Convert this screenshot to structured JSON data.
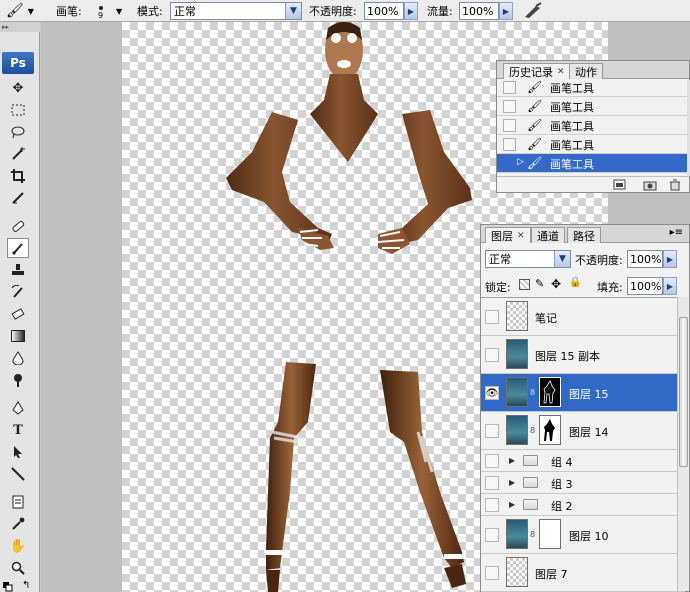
{
  "options_bar": {
    "brush_label": "画笔:",
    "brush_size": "9",
    "mode_label": "模式:",
    "mode_value": "正常",
    "opacity_label": "不透明度:",
    "opacity_value": "100%",
    "flow_label": "流量:",
    "flow_value": "100%"
  },
  "toolbox": {
    "logo": "Ps",
    "tools": [
      "move-icon",
      "marquee-icon",
      "lasso-icon",
      "magic-wand-icon",
      "crop-icon",
      "slice-icon",
      "healing-brush-icon",
      "brush-icon",
      "clone-stamp-icon",
      "history-brush-icon",
      "eraser-icon",
      "gradient-icon",
      "blur-icon",
      "dodge-icon",
      "pen-icon",
      "type-icon",
      "path-selection-icon",
      "line-icon",
      "notes-icon",
      "eyedropper-icon",
      "hand-icon",
      "zoom-icon"
    ],
    "active_tool": "brush-icon"
  },
  "history_panel": {
    "tabs": [
      {
        "label": "历史记录",
        "active": true
      },
      {
        "label": "动作",
        "active": false
      }
    ],
    "items": [
      "画笔工具",
      "画笔工具",
      "画笔工具",
      "画笔工具",
      "画笔工具"
    ],
    "selected_index": 4,
    "footer_icons": [
      "new-document-from-state-icon",
      "snapshot-icon",
      "trash-icon"
    ]
  },
  "layers_panel": {
    "tabs": [
      {
        "label": "图层",
        "active": true
      },
      {
        "label": "通道",
        "active": false
      },
      {
        "label": "路径",
        "active": false
      }
    ],
    "blend_mode": "正常",
    "opacity_label": "不透明度:",
    "opacity_value": "100%",
    "lock_label": "锁定:",
    "fill_label": "填充:",
    "fill_value": "100%",
    "layers": [
      {
        "name": "笔记",
        "kind": "layer",
        "thumb": "transparent",
        "mask": "none",
        "visible": false,
        "active": false
      },
      {
        "name": "图层 15 副本",
        "kind": "layer",
        "thumb": "photo",
        "mask": "none",
        "visible": false,
        "active": false
      },
      {
        "name": "图层 15",
        "kind": "layer",
        "thumb": "photo",
        "mask": "black-silhouette",
        "visible": true,
        "active": true
      },
      {
        "name": "图层 14",
        "kind": "layer",
        "thumb": "photo",
        "mask": "white-silhouette",
        "visible": false,
        "active": false
      },
      {
        "name": "组 4",
        "kind": "group",
        "visible": false,
        "active": false
      },
      {
        "name": "组 3",
        "kind": "group",
        "visible": false,
        "active": false
      },
      {
        "name": "组 2",
        "kind": "group",
        "visible": false,
        "active": false
      },
      {
        "name": "图层 10",
        "kind": "layer",
        "thumb": "photo",
        "mask": "white",
        "visible": false,
        "active": false
      },
      {
        "name": "图层 7",
        "kind": "layer",
        "thumb": "transparent",
        "mask": "none",
        "visible": false,
        "active": false
      }
    ]
  }
}
